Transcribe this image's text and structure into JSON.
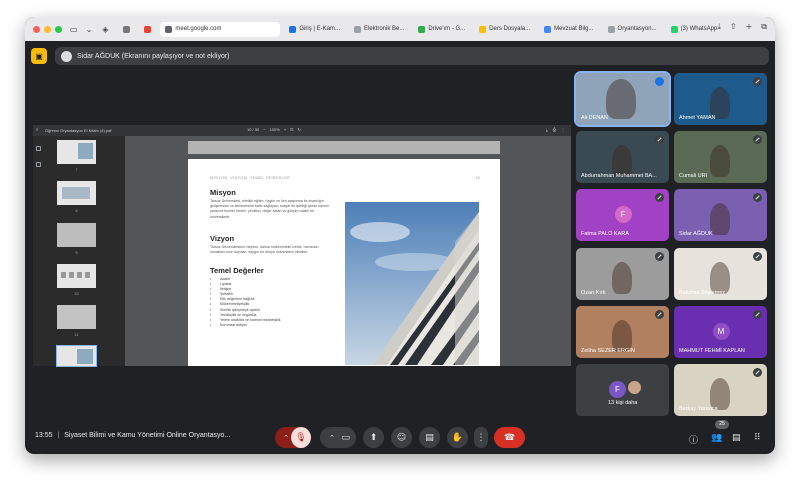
{
  "browser": {
    "tabs": [
      {
        "label": "meet.google.com",
        "color": "#5f6368",
        "active": true
      },
      {
        "label": "Giriş | E-Kam...",
        "color": "#1a73e8"
      },
      {
        "label": "Elektronik Be...",
        "color": "#9aa0a6"
      },
      {
        "label": "Drive'ım - G...",
        "color": "#34a853"
      },
      {
        "label": "Ders Dosyala...",
        "color": "#fbbc04"
      },
      {
        "label": "Mevzuat Bilg...",
        "color": "#4285f4"
      },
      {
        "label": "Oryantasyon...",
        "color": "#9aa0a6"
      },
      {
        "label": "(3) WhatsApp",
        "color": "#25d366"
      }
    ]
  },
  "banner": {
    "text": "Sidar AĞDUK (Ekranını paylaşıyor ve not ekliyor)"
  },
  "pdf": {
    "filename": "Öğrenci Oryantasyon El Kitabı (4).pdf",
    "page_counter": "10 / 30",
    "zoom": "100%",
    "thumb_numbers": [
      "7",
      "8",
      "9",
      "10",
      "11",
      "12"
    ],
    "page": {
      "header": "MİSYON, VİZYON, TEMEL DEĞERLER",
      "number": "10",
      "mission_title": "Misyon",
      "mission_text": "Tarsus Üniversitesi, nitelikli eğitim, özgün ve ileri araştırma ile insanlığın gelişmesine ve ilerlemesine katkı sağlayan; sosyal bir işletliği içinde toplum yararına hizmet üreten, yenilikçi, değer katan ve gelişim odaklı bir üniversitedir.",
      "vision_title": "Vizyon",
      "vision_text": "Tarsus Üniversitesinin vizyonu, daima mükemmelin izinde, mensubu olmaktan onur duyulan, saygın bir dünya üniversitesi olmaktır.",
      "values_title": "Temel Değerler",
      "values": [
        "Adalet",
        "Liyakat",
        "İletişim",
        "Şeffaflık",
        "Etik değerlere bağlılık",
        "Mükemmeliyetçilik",
        "Sürekli iyileşmeye açıklık",
        "Yenilikçilik ve özgünlük",
        "Yerele odaklılık ve küresel rekabetçilik",
        "Kurumsal aidiyet"
      ]
    }
  },
  "participants": [
    {
      "name": "Ali DENAN",
      "bg": "#8fa4b8",
      "status": "speaking"
    },
    {
      "name": "Ahmet YAMAN",
      "bg": "#1e5b8c",
      "status": "muted"
    },
    {
      "name": "Abdurrahman Muhammet BA...",
      "bg": "#3a4a52",
      "status": "muted"
    },
    {
      "name": "Cumali URI",
      "bg": "#5a6a55",
      "status": "muted"
    },
    {
      "name": "Fatma PALO KARA",
      "bg": "#a142c4",
      "status": "muted",
      "initial": "F",
      "avatar": "#d36ac9"
    },
    {
      "name": "Sidar AĞDUK",
      "bg": "#7b5fb0",
      "status": "muted"
    },
    {
      "name": "Ozan Kırk",
      "bg": "#9c9c9c",
      "status": "muted"
    },
    {
      "name": "Batuhan Söylemez",
      "bg": "#e7e3dc",
      "status": "muted"
    },
    {
      "name": "Zeliha SEZER ERGIN",
      "bg": "#b08060",
      "status": "muted"
    },
    {
      "name": "MAHMUT FEHMİ KAPLAN",
      "bg": "#6a2fb0",
      "status": "muted",
      "initial": "M",
      "avatar": "#8e4fc9"
    },
    {
      "name": "13 kişi daha",
      "bg": "#3c4043",
      "status": "none",
      "initial": "F",
      "avatar": "#7b57c6"
    },
    {
      "name": "Berkay Yarımca",
      "bg": "#d9d3c4",
      "status": "muted"
    }
  ],
  "bottom": {
    "time": "13:55",
    "title": "Siyaset Bilimi ve Kamu Yönetimi Online Oryantasyo...",
    "participant_count": "25"
  }
}
